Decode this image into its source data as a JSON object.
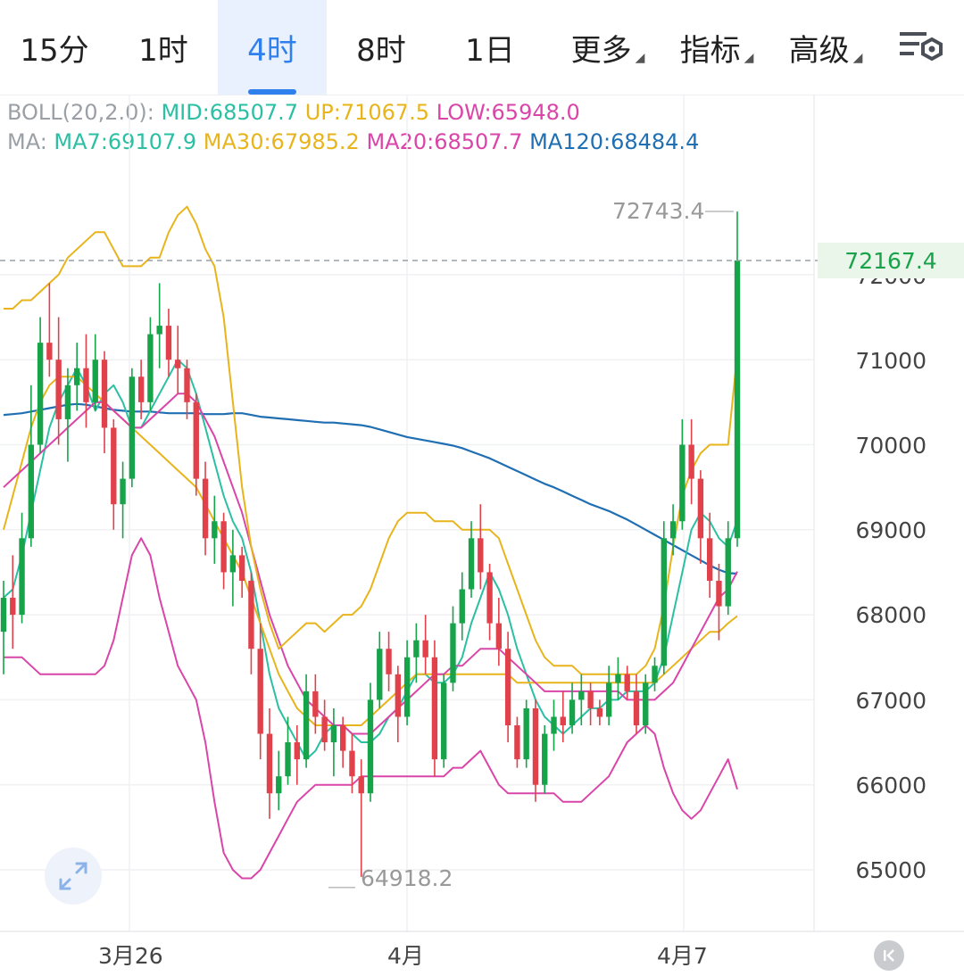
{
  "tabs": [
    {
      "label": "15分",
      "active": false
    },
    {
      "label": "1时",
      "active": false
    },
    {
      "label": "4时",
      "active": true
    },
    {
      "label": "8时",
      "active": false
    },
    {
      "label": "1日",
      "active": false
    },
    {
      "label": "更多",
      "active": false,
      "dropdown": true
    },
    {
      "label": "指标",
      "active": false,
      "dropdown": true
    },
    {
      "label": "高级",
      "active": false,
      "dropdown": true
    }
  ],
  "legend": {
    "boll_prefix": "BOLL(20,2.0): ",
    "boll_mid": "MID:68507.7",
    "boll_up": "UP:71067.5",
    "boll_low": "LOW:65948.0",
    "ma_prefix": "MA: ",
    "ma7": "MA7:69107.9",
    "ma30": "MA30:67985.2",
    "ma20": "MA20:68507.7",
    "ma120": "MA120:68484.4"
  },
  "colors": {
    "up": "#17a34a",
    "down": "#e0414b",
    "mid": "#2bbfa3",
    "upper": "#e8b41c",
    "lower": "#d945a8",
    "ma7": "#2bbfa3",
    "ma30": "#e8b41c",
    "ma20": "#d945a8",
    "ma120": "#1f6fb2",
    "accent": "#2f80ed"
  },
  "price_axis": [
    "72000",
    "71000",
    "70000",
    "69000",
    "68000",
    "67000",
    "66000",
    "65000"
  ],
  "current_price": "72167.4",
  "high_label": "72743.4",
  "low_label": "64918.2",
  "date_axis": [
    "3月26",
    "4月",
    "4月7"
  ],
  "icons": {
    "settings": "chart-settings-icon",
    "expand": "expand-icon",
    "back": "scroll-to-latest-icon"
  },
  "chart_data": {
    "type": "candlestick",
    "ylim": [
      64500,
      73300
    ],
    "candles": [
      [
        67800,
        68400,
        67300,
        68200
      ],
      [
        68200,
        68700,
        67600,
        68000
      ],
      [
        68000,
        69200,
        67900,
        68900
      ],
      [
        68900,
        70700,
        68800,
        70000
      ],
      [
        70000,
        71500,
        69900,
        71200
      ],
      [
        71200,
        71900,
        70800,
        71000
      ],
      [
        71000,
        71500,
        70000,
        70300
      ],
      [
        70300,
        70900,
        69800,
        70700
      ],
      [
        70700,
        71200,
        70400,
        70900
      ],
      [
        70900,
        71300,
        70200,
        70500
      ],
      [
        70500,
        71300,
        70400,
        71000
      ],
      [
        71000,
        71100,
        69900,
        70200
      ],
      [
        70200,
        70300,
        69000,
        69300
      ],
      [
        69300,
        69800,
        68900,
        69600
      ],
      [
        69600,
        70900,
        69500,
        70800
      ],
      [
        70800,
        71000,
        70300,
        70500
      ],
      [
        70500,
        71500,
        70400,
        71300
      ],
      [
        71300,
        71900,
        70900,
        71400
      ],
      [
        71400,
        71600,
        70800,
        71000
      ],
      [
        71000,
        71400,
        70600,
        70900
      ],
      [
        70900,
        71000,
        70300,
        70500
      ],
      [
        70500,
        70600,
        69400,
        69600
      ],
      [
        69600,
        69800,
        68700,
        68900
      ],
      [
        68900,
        69400,
        68600,
        69100
      ],
      [
        69100,
        69200,
        68300,
        68500
      ],
      [
        68500,
        69000,
        68100,
        68700
      ],
      [
        68700,
        68800,
        68200,
        68400
      ],
      [
        68400,
        68500,
        67300,
        67600
      ],
      [
        67600,
        67900,
        66300,
        66600
      ],
      [
        66600,
        66900,
        65600,
        65900
      ],
      [
        65900,
        66400,
        65700,
        66100
      ],
      [
        66100,
        66800,
        66000,
        66500
      ],
      [
        66500,
        66700,
        66000,
        66300
      ],
      [
        66300,
        67300,
        66200,
        67100
      ],
      [
        67100,
        67300,
        66600,
        66800
      ],
      [
        66800,
        67000,
        66400,
        66500
      ],
      [
        66500,
        66900,
        66100,
        66700
      ],
      [
        66700,
        66800,
        66200,
        66400
      ],
      [
        66400,
        66600,
        65900,
        66100
      ],
      [
        66100,
        66300,
        64918,
        65900
      ],
      [
        65900,
        67200,
        65800,
        67000
      ],
      [
        67000,
        67800,
        66900,
        67600
      ],
      [
        67600,
        67800,
        67100,
        67300
      ],
      [
        67300,
        67400,
        66500,
        66800
      ],
      [
        66800,
        67700,
        66700,
        67500
      ],
      [
        67500,
        67900,
        67200,
        67700
      ],
      [
        67700,
        68000,
        67300,
        67500
      ],
      [
        67500,
        67700,
        66100,
        66300
      ],
      [
        66300,
        67300,
        66200,
        67200
      ],
      [
        67200,
        68100,
        67100,
        67900
      ],
      [
        67900,
        68500,
        67700,
        68300
      ],
      [
        68300,
        69100,
        68200,
        68900
      ],
      [
        68900,
        69300,
        68300,
        68500
      ],
      [
        68500,
        68600,
        67700,
        67900
      ],
      [
        67900,
        68200,
        67400,
        67600
      ],
      [
        67600,
        67800,
        66500,
        66700
      ],
      [
        66700,
        66800,
        66200,
        66300
      ],
      [
        66300,
        67000,
        66200,
        66900
      ],
      [
        66900,
        67000,
        65800,
        66000
      ],
      [
        66000,
        66700,
        65900,
        66600
      ],
      [
        66600,
        67000,
        66400,
        66800
      ],
      [
        66800,
        67100,
        66500,
        66700
      ],
      [
        66700,
        67200,
        66600,
        67000
      ],
      [
        67000,
        67300,
        66700,
        67100
      ],
      [
        67100,
        67200,
        66700,
        66900
      ],
      [
        66900,
        67000,
        66700,
        66800
      ],
      [
        66800,
        67400,
        66700,
        67200
      ],
      [
        67200,
        67500,
        67000,
        67300
      ],
      [
        67300,
        67400,
        67000,
        67100
      ],
      [
        67100,
        67300,
        66600,
        66700
      ],
      [
        66700,
        67300,
        66600,
        67200
      ],
      [
        67200,
        67500,
        67100,
        67400
      ],
      [
        67400,
        69100,
        67300,
        68900
      ],
      [
        68900,
        69300,
        68700,
        69100
      ],
      [
        69100,
        70300,
        69000,
        70000
      ],
      [
        70000,
        70300,
        69300,
        69600
      ],
      [
        69600,
        69700,
        68600,
        68900
      ],
      [
        68900,
        69200,
        68200,
        68400
      ],
      [
        68400,
        68600,
        67700,
        68100
      ],
      [
        68100,
        69100,
        68000,
        68900
      ],
      [
        68900,
        72743,
        68800,
        72167
      ]
    ],
    "series": [
      {
        "name": "MA120",
        "values": [
          70350,
          70360,
          70370,
          70390,
          70410,
          70430,
          70450,
          70470,
          70480,
          70470,
          70450,
          70430,
          70410,
          70400,
          70390,
          70390,
          70390,
          70380,
          70370,
          70370,
          70370,
          70370,
          70360,
          70360,
          70360,
          70370,
          70370,
          70350,
          70330,
          70320,
          70310,
          70300,
          70290,
          70280,
          70270,
          70260,
          70260,
          70250,
          70240,
          70230,
          70210,
          70180,
          70150,
          70120,
          70090,
          70070,
          70050,
          70030,
          70010,
          69990,
          69960,
          69920,
          69880,
          69840,
          69790,
          69740,
          69690,
          69640,
          69590,
          69540,
          69500,
          69450,
          69400,
          69350,
          69300,
          69260,
          69220,
          69170,
          69120,
          69060,
          69000,
          68940,
          68880,
          68820,
          68760,
          68700,
          68640,
          68580,
          68530,
          68490,
          68484
        ]
      },
      {
        "name": "MA7",
        "values": [
          68200,
          68300,
          68700,
          69200,
          69700,
          70200,
          70500,
          70700,
          70900,
          70700,
          70400,
          70600,
          70700,
          70500,
          70200,
          70200,
          70400,
          70600,
          70800,
          71000,
          70900,
          70600,
          70200,
          69800,
          69400,
          69100,
          68900,
          68500,
          67900,
          67300,
          66900,
          66700,
          66500,
          66300,
          66400,
          66600,
          66700,
          66700,
          66600,
          66500,
          66500,
          66600,
          66800,
          66900,
          67100,
          67300,
          67300,
          67200,
          67200,
          67300,
          67500,
          67900,
          68200,
          68500,
          68300,
          68000,
          67600,
          67300,
          67000,
          66800,
          66700,
          66600,
          66700,
          66800,
          66900,
          66900,
          67000,
          67000,
          67100,
          67100,
          67100,
          67200,
          67500,
          68000,
          68500,
          69000,
          69200,
          69100,
          68900,
          68800,
          69108
        ]
      },
      {
        "name": "MA30",
        "values": [
          69000,
          69400,
          69800,
          70200,
          70500,
          70700,
          70800,
          70800,
          70800,
          70700,
          70600,
          70500,
          70400,
          70300,
          70200,
          70100,
          70000,
          69900,
          69800,
          69700,
          69600,
          69500,
          69300,
          69100,
          68900,
          68700,
          68500,
          68200,
          67900,
          67600,
          67300,
          67100,
          66900,
          66800,
          66700,
          66700,
          66700,
          66700,
          66700,
          66700,
          66800,
          66900,
          67000,
          67100,
          67200,
          67300,
          67300,
          67300,
          67300,
          67300,
          67300,
          67300,
          67300,
          67300,
          67300,
          67300,
          67200,
          67200,
          67200,
          67200,
          67200,
          67200,
          67200,
          67200,
          67200,
          67200,
          67200,
          67200,
          67200,
          67200,
          67200,
          67200,
          67300,
          67400,
          67500,
          67600,
          67700,
          67800,
          67800,
          67900,
          67985
        ]
      },
      {
        "name": "MID",
        "values": [
          69500,
          69600,
          69700,
          69800,
          69900,
          70000,
          70100,
          70200,
          70300,
          70400,
          70500,
          70500,
          70400,
          70300,
          70200,
          70200,
          70300,
          70400,
          70500,
          70600,
          70600,
          70500,
          70300,
          70100,
          69800,
          69500,
          69200,
          68800,
          68400,
          68000,
          67700,
          67400,
          67200,
          67000,
          66900,
          66800,
          66700,
          66700,
          66600,
          66600,
          66600,
          66700,
          66800,
          66900,
          67000,
          67100,
          67200,
          67300,
          67300,
          67400,
          67400,
          67500,
          67600,
          67600,
          67600,
          67500,
          67400,
          67300,
          67200,
          67100,
          67100,
          67100,
          67100,
          67100,
          67100,
          67100,
          67100,
          67100,
          67000,
          67000,
          67000,
          67000,
          67100,
          67200,
          67400,
          67600,
          67800,
          68000,
          68200,
          68300,
          68508
        ]
      },
      {
        "name": "UP",
        "values": [
          71600,
          71600,
          71700,
          71700,
          71800,
          71900,
          72000,
          72200,
          72300,
          72400,
          72500,
          72500,
          72300,
          72100,
          72100,
          72100,
          72200,
          72200,
          72500,
          72700,
          72800,
          72600,
          72300,
          72100,
          71500,
          70500,
          69500,
          68800,
          68300,
          67900,
          67600,
          67700,
          67800,
          67900,
          67900,
          67800,
          67900,
          68000,
          68000,
          68100,
          68300,
          68600,
          68900,
          69100,
          69200,
          69200,
          69200,
          69100,
          69100,
          69100,
          69000,
          69000,
          69000,
          69000,
          68900,
          68600,
          68300,
          68000,
          67700,
          67500,
          67400,
          67400,
          67400,
          67300,
          67300,
          67300,
          67300,
          67300,
          67300,
          67300,
          67400,
          67600,
          68100,
          68800,
          69400,
          69700,
          69900,
          70000,
          70000,
          70000,
          71068
        ]
      },
      {
        "name": "LOW",
        "values": [
          67500,
          67500,
          67500,
          67400,
          67300,
          67300,
          67300,
          67300,
          67300,
          67300,
          67300,
          67400,
          67700,
          68200,
          68700,
          68900,
          68700,
          68200,
          67800,
          67400,
          67200,
          67000,
          66500,
          65800,
          65200,
          65000,
          64900,
          64900,
          65000,
          65200,
          65400,
          65600,
          65800,
          65900,
          66000,
          66000,
          66000,
          66000,
          66000,
          66100,
          66100,
          66100,
          66100,
          66100,
          66100,
          66100,
          66100,
          66100,
          66100,
          66200,
          66200,
          66300,
          66400,
          66200,
          66000,
          65900,
          65900,
          65900,
          65900,
          65900,
          65900,
          65800,
          65800,
          65800,
          65900,
          66000,
          66100,
          66300,
          66500,
          66600,
          66700,
          66600,
          66200,
          65900,
          65700,
          65600,
          65700,
          65900,
          66100,
          66300,
          65948
        ]
      }
    ]
  }
}
